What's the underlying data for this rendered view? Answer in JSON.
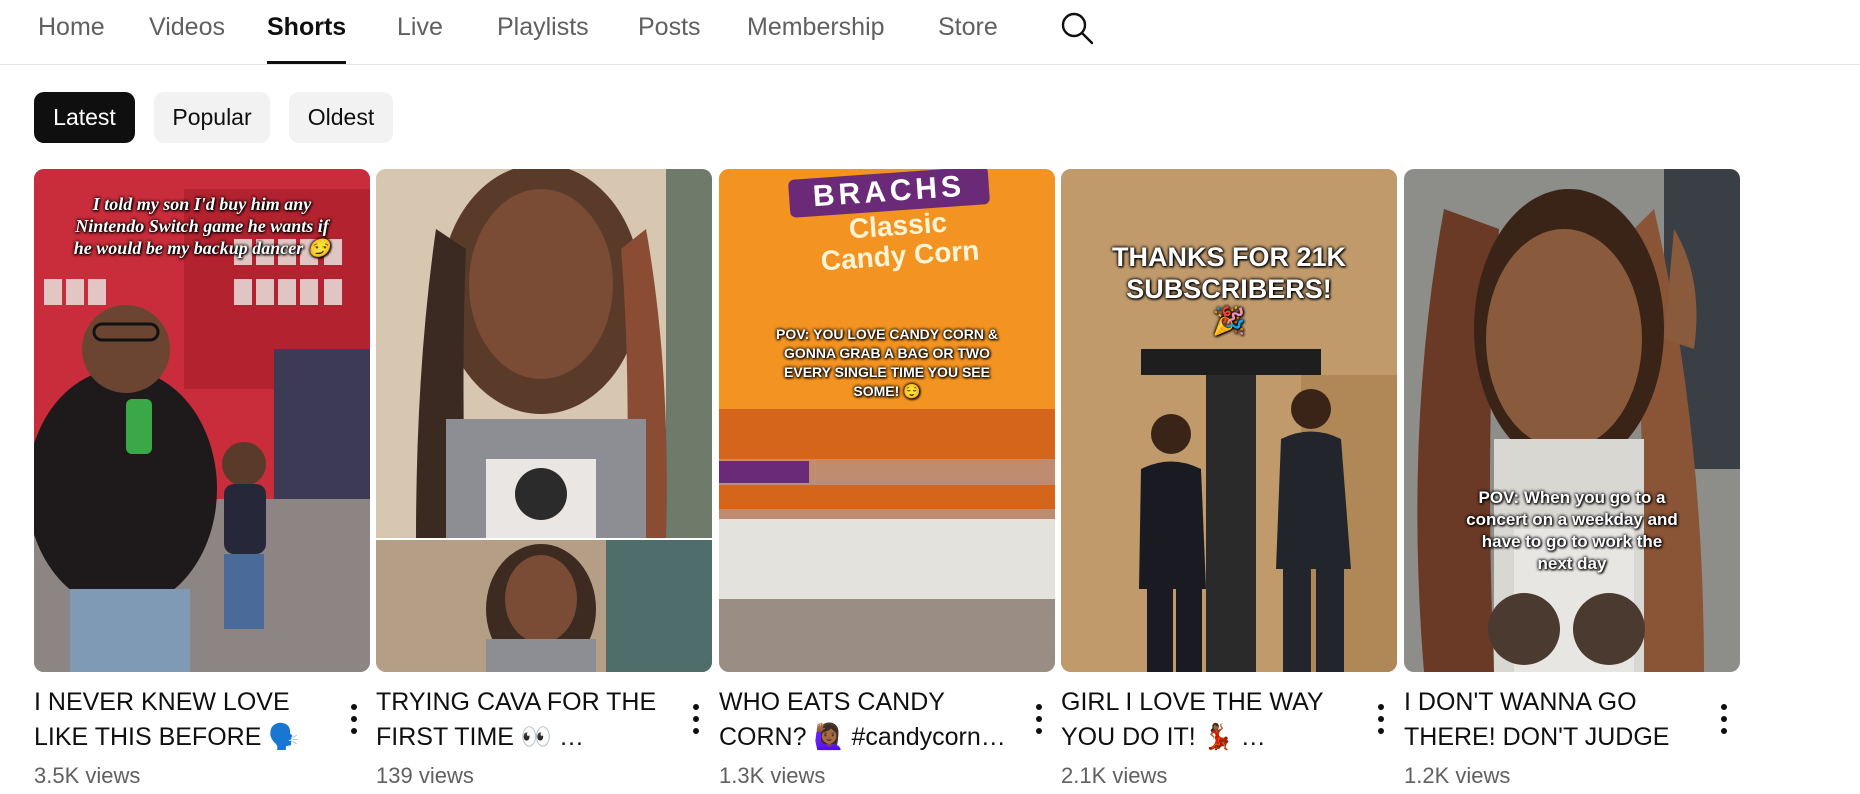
{
  "tabs": [
    {
      "label": "Home",
      "active": false
    },
    {
      "label": "Videos",
      "active": false
    },
    {
      "label": "Shorts",
      "active": true
    },
    {
      "label": "Live",
      "active": false
    },
    {
      "label": "Playlists",
      "active": false
    },
    {
      "label": "Posts",
      "active": false
    },
    {
      "label": "Membership",
      "active": false
    },
    {
      "label": "Store",
      "active": false
    }
  ],
  "search_icon": "search-icon",
  "chips": [
    {
      "label": "Latest",
      "selected": true
    },
    {
      "label": "Popular",
      "selected": false
    },
    {
      "label": "Oldest",
      "selected": false
    }
  ],
  "shorts": [
    {
      "title": "I NEVER KNEW LOVE\nLIKE THIS BEFORE 🗣️ …",
      "views": "3.5K views",
      "overlay": "I told my son I'd buy him any Nintendo Switch game he wants if he would be my backup dancer 😏"
    },
    {
      "title": "TRYING CAVA FOR THE\nFIRST TIME 👀 …",
      "views": "139 views",
      "overlay": ""
    },
    {
      "title": "WHO EATS CANDY\nCORN? 🙋🏾‍♀️ #candycorn…",
      "views": "1.3K views",
      "overlay": "POV: YOU LOVE CANDY CORN & GONNA GRAB A BAG OR TWO EVERY SINGLE TIME YOU SEE SOME! 😌",
      "brand": "BRACHS",
      "product": "Classic Candy Corn"
    },
    {
      "title": "GIRL I LOVE THE WAY\nYOU DO IT! 💃🏾 …",
      "views": "2.1K views",
      "overlay": "THANKS FOR 21K SUBSCRIBERS! 🎉"
    },
    {
      "title": "I DON'T WANNA GO\nTHERE! DON'T JUDGE …",
      "views": "1.2K views",
      "overlay": "POV: When you go to a concert on a weekday and have to go to work the next day"
    }
  ],
  "more_icon": "more-vertical-icon",
  "colors": {
    "accent": "#0f0f0f",
    "muted": "#606060",
    "chip_bg": "#f2f2f2",
    "divider": "#e5e5e5"
  }
}
